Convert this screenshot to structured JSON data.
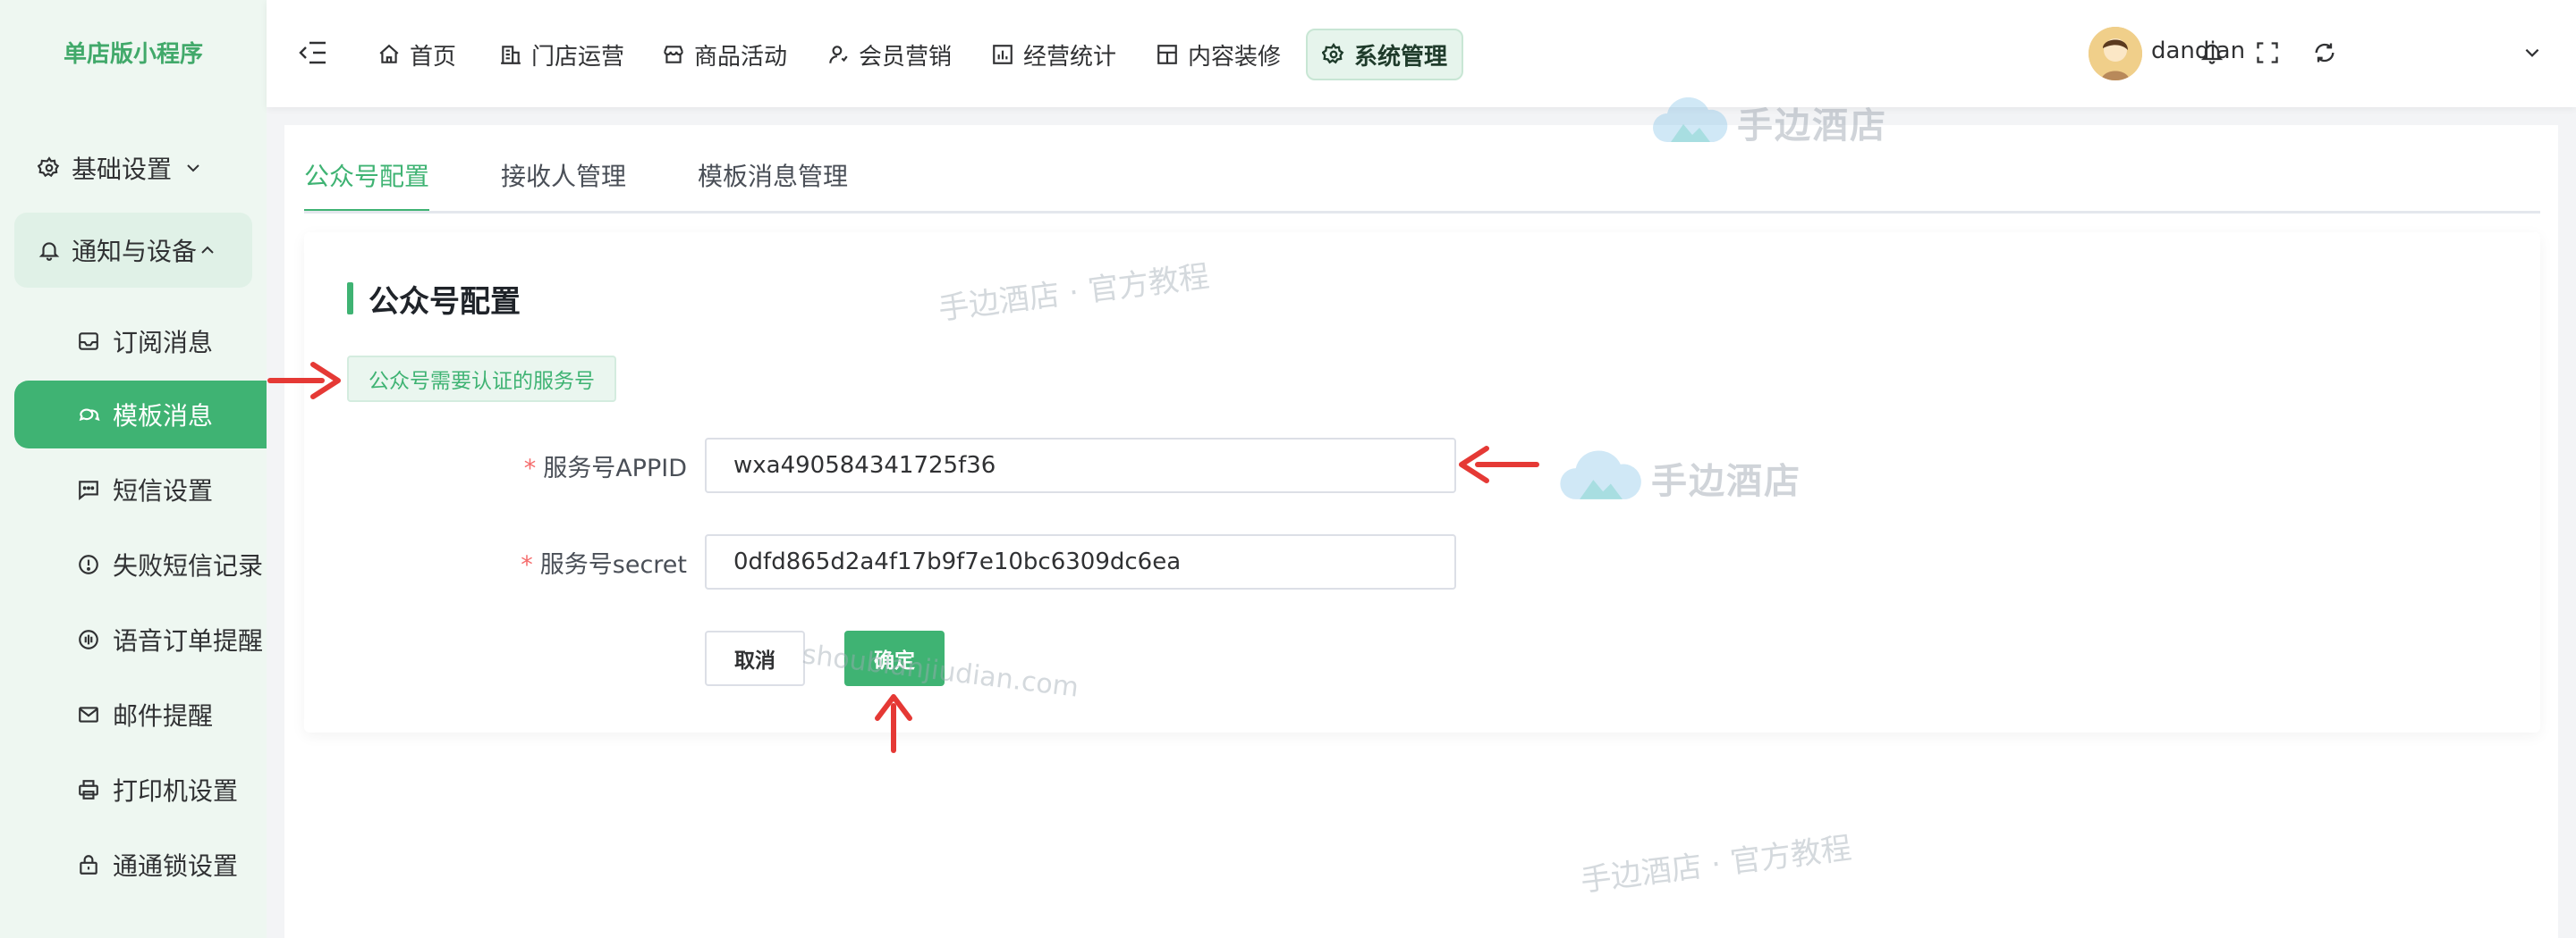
{
  "sidebar": {
    "brand": "单店版小程序",
    "groups": [
      {
        "label": "基础设置",
        "icon": "gear-icon"
      },
      {
        "label": "通知与设备",
        "icon": "bell-icon"
      }
    ],
    "items": [
      {
        "label": "订阅消息",
        "icon": "inbox-icon"
      },
      {
        "label": "模板消息",
        "icon": "chat-icon"
      },
      {
        "label": "短信设置",
        "icon": "message-icon"
      },
      {
        "label": "失败短信记录",
        "icon": "alert-circle-icon"
      },
      {
        "label": "语音订单提醒",
        "icon": "voice-icon"
      },
      {
        "label": "邮件提醒",
        "icon": "mail-icon"
      },
      {
        "label": "打印机设置",
        "icon": "printer-icon"
      },
      {
        "label": "通通锁设置",
        "icon": "lock-icon"
      }
    ]
  },
  "header": {
    "nav": [
      {
        "label": "首页",
        "icon": "home-icon"
      },
      {
        "label": "门店运营",
        "icon": "store-icon"
      },
      {
        "label": "商品活动",
        "icon": "shop-icon"
      },
      {
        "label": "会员营销",
        "icon": "user-icon"
      },
      {
        "label": "经营统计",
        "icon": "bar-chart-icon"
      },
      {
        "label": "内容装修",
        "icon": "layout-icon"
      },
      {
        "label": "系统管理",
        "icon": "settings-icon"
      }
    ],
    "username": "dandian"
  },
  "tabs": [
    "公众号配置",
    "接收人管理",
    "模板消息管理"
  ],
  "form": {
    "title": "公众号配置",
    "notice": "公众号需要认证的服务号",
    "appid_label": "服务号APPID",
    "appid_value": "wxa490584341725f36",
    "secret_label": "服务号secret",
    "secret_value": "0dfd865d2a4f17b9f7e10bc6309dc6ea",
    "required_mark": "*",
    "cancel_label": "取消",
    "confirm_label": "确定"
  },
  "watermarks": {
    "brand": "手边酒店",
    "tutorial": "手边酒店 · 官方教程",
    "url": "shoubianjiudian.com"
  },
  "colors": {
    "accent": "#3fb373",
    "sidebar_bg": "#eef7f1",
    "arrow": "#e53935"
  }
}
